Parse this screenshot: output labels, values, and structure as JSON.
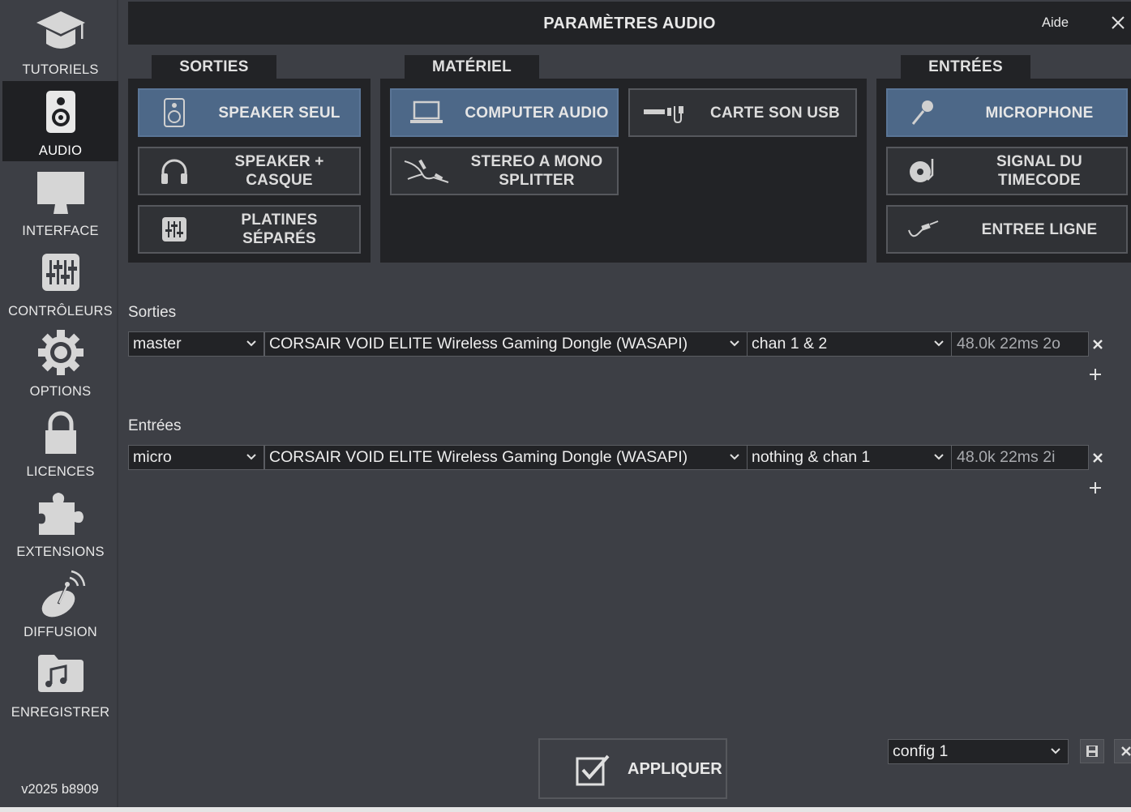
{
  "window": {
    "title": "PARAMÈTRES AUDIO",
    "help_label": "Aide"
  },
  "sidebar": {
    "items": [
      {
        "label": "TUTORIELS",
        "icon": "graduation-cap-icon",
        "active": false
      },
      {
        "label": "AUDIO",
        "icon": "speaker-icon",
        "active": true
      },
      {
        "label": "INTERFACE",
        "icon": "monitor-icon",
        "active": false
      },
      {
        "label": "CONTRÔLEURS",
        "icon": "sliders-icon",
        "active": false
      },
      {
        "label": "OPTIONS",
        "icon": "gear-icon",
        "active": false
      },
      {
        "label": "LICENCES",
        "icon": "lock-icon",
        "active": false
      },
      {
        "label": "EXTENSIONS",
        "icon": "puzzle-icon",
        "active": false
      },
      {
        "label": "DIFFUSION",
        "icon": "satellite-dish-icon",
        "active": false
      },
      {
        "label": "ENREGISTRER",
        "icon": "music-folder-icon",
        "active": false
      }
    ],
    "version": "v2025 b8909"
  },
  "outputs_panel": {
    "tab": "SORTIES",
    "buttons": [
      {
        "label": "SPEAKER SEUL",
        "icon": "speaker-icon",
        "selected": true
      },
      {
        "label_line1": "SPEAKER +",
        "label_line2": "CASQUE",
        "icon": "headphones-icon",
        "selected": false
      },
      {
        "label_line1": "PLATINES",
        "label_line2": "SÉPARÉS",
        "icon": "mixer-icon",
        "selected": false
      }
    ]
  },
  "hardware_panel": {
    "tab": "MATÉRIEL",
    "buttons": [
      {
        "label": "COMPUTER AUDIO",
        "icon": "laptop-icon",
        "selected": true
      },
      {
        "label": "CARTE SON USB",
        "icon": "usb-soundcard-icon",
        "selected": false
      },
      {
        "label_line1": "STEREO A MONO",
        "label_line2": "SPLITTER",
        "icon": "splitter-cable-icon",
        "selected": false
      }
    ]
  },
  "inputs_panel": {
    "tab": "ENTRÉES",
    "buttons": [
      {
        "label": "MICROPHONE",
        "icon": "microphone-icon",
        "selected": true
      },
      {
        "label_line1": "SIGNAL DU",
        "label_line2": "TIMECODE",
        "icon": "turntable-icon",
        "selected": false
      },
      {
        "label": "ENTREE LIGNE",
        "icon": "line-cable-icon",
        "selected": false
      }
    ]
  },
  "routing": {
    "outputs": {
      "label": "Sorties",
      "rows": [
        {
          "role": "master",
          "device": "CORSAIR VOID ELITE Wireless Gaming Dongle (WASAPI)",
          "channels": "chan 1 & 2",
          "info": "48.0k 22ms 2o"
        }
      ]
    },
    "inputs": {
      "label": "Entrées",
      "rows": [
        {
          "role": "micro",
          "device": "CORSAIR VOID ELITE Wireless Gaming Dongle (WASAPI)",
          "channels": "nothing & chan 1",
          "info": "48.0k 22ms 2i"
        }
      ]
    }
  },
  "footer": {
    "apply_label": "APPLIQUER",
    "config_value": "config 1"
  }
}
